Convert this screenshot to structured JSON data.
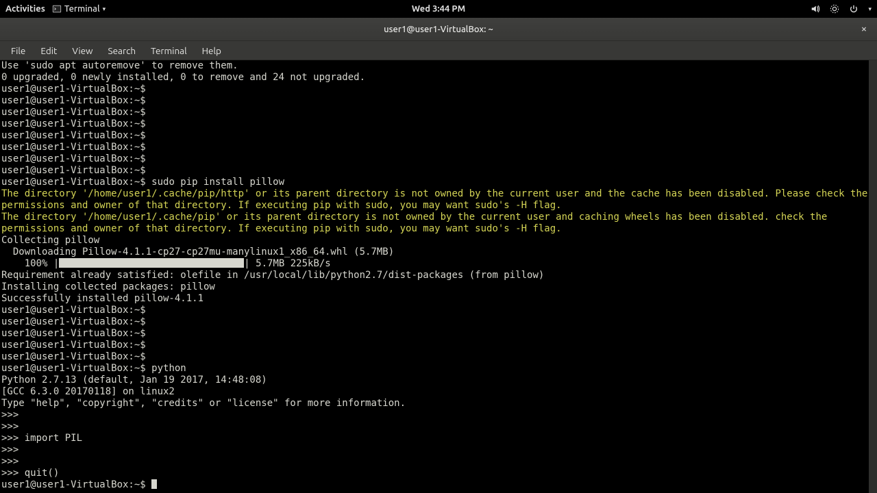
{
  "topbar": {
    "activities": "Activities",
    "app_name": "Terminal",
    "clock": "Wed  3:44 PM"
  },
  "window": {
    "title": "user1@user1-VirtualBox: ~"
  },
  "menubar": [
    "File",
    "Edit",
    "View",
    "Search",
    "Terminal",
    "Help"
  ],
  "term": {
    "line_autoremove": "Use 'sudo apt autoremove' to remove them.",
    "line_upgrade": "0 upgraded, 0 newly installed, 0 to remove and 24 not upgraded.",
    "prompt": "user1@user1-VirtualBox:~$ ",
    "cmd_pip": "sudo pip install pillow",
    "warn1": "The directory '/home/user1/.cache/pip/http' or its parent directory is not owned by the current user and the cache has been disabled. Please check the permissions and owner of that directory. If executing pip with sudo, you may want sudo's -H flag.",
    "warn2": "The directory '/home/user1/.cache/pip' or its parent directory is not owned by the current user and caching wheels has been disabled. check the permissions and owner of that directory. If executing pip with sudo, you may want sudo's -H flag.",
    "collecting": "Collecting pillow",
    "downloading": "  Downloading Pillow-4.1.1-cp27-cp27mu-manylinux1_x86_64.whl (5.7MB)",
    "progress_pre": "    100% |",
    "progress_post": "| 5.7MB 225kB/s",
    "req_satisfied": "Requirement already satisfied: olefile in /usr/local/lib/python2.7/dist-packages (from pillow)",
    "installing": "Installing collected packages: pillow",
    "success": "Successfully installed pillow-4.1.1",
    "cmd_python": "python",
    "py_version": "Python 2.7.13 (default, Jan 19 2017, 14:48:08) ",
    "py_gcc": "[GCC 6.3.0 20170118] on linux2",
    "py_help": "Type \"help\", \"copyright\", \"credits\" or \"license\" for more information.",
    "py_prompt": ">>> ",
    "py_import": "import PIL",
    "py_quit": "quit()"
  }
}
